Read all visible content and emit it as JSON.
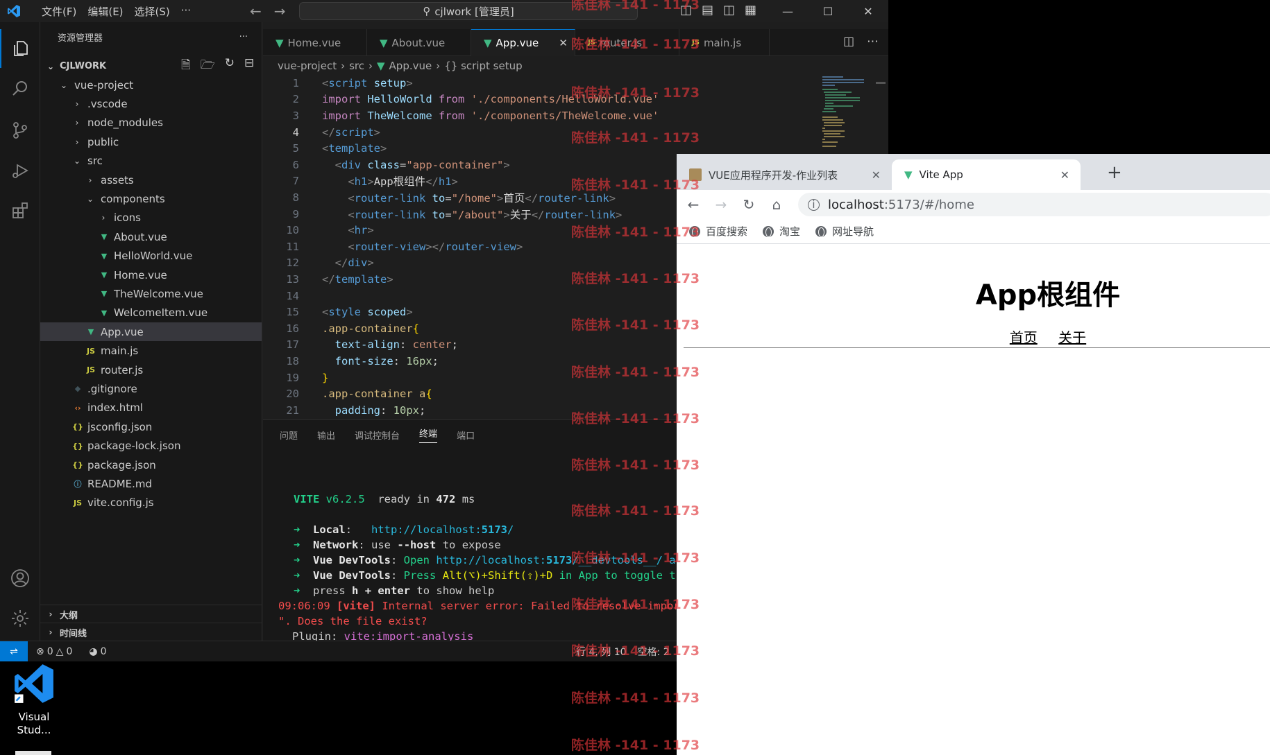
{
  "vscode": {
    "menu": [
      "文件(F)",
      "编辑(E)",
      "选择(S)",
      "···"
    ],
    "command_center": "cjlwork [管理员]",
    "activity": [
      "explorer-icon",
      "search-icon",
      "source-control-icon",
      "run-debug-icon",
      "extensions-icon",
      "account-icon",
      "settings-gear-icon"
    ],
    "sidebar": {
      "title": "资源管理器",
      "more": "···",
      "root": "CJLWORK",
      "tree": [
        {
          "label": "vue-project",
          "type": "folder-open",
          "icon": ""
        },
        {
          "label": ".vscode",
          "type": "folder",
          "icon": ""
        },
        {
          "label": "node_modules",
          "type": "folder",
          "icon": ""
        },
        {
          "label": "public",
          "type": "folder",
          "icon": ""
        },
        {
          "label": "src",
          "type": "folder-open",
          "icon": ""
        },
        {
          "label": "assets",
          "type": "folder",
          "icon": ""
        },
        {
          "label": "components",
          "type": "folder-open",
          "icon": ""
        },
        {
          "label": "icons",
          "type": "folder",
          "icon": ""
        },
        {
          "label": "About.vue",
          "type": "file",
          "icon": "vue"
        },
        {
          "label": "HelloWorld.vue",
          "type": "file",
          "icon": "vue"
        },
        {
          "label": "Home.vue",
          "type": "file",
          "icon": "vue"
        },
        {
          "label": "TheWelcome.vue",
          "type": "file",
          "icon": "vue"
        },
        {
          "label": "WelcomeItem.vue",
          "type": "file",
          "icon": "vue"
        },
        {
          "label": "App.vue",
          "type": "file",
          "icon": "vue"
        },
        {
          "label": "main.js",
          "type": "file",
          "icon": "js"
        },
        {
          "label": "router.js",
          "type": "file",
          "icon": "js"
        },
        {
          "label": ".gitignore",
          "type": "file",
          "icon": "git"
        },
        {
          "label": "index.html",
          "type": "file",
          "icon": "html"
        },
        {
          "label": "jsconfig.json",
          "type": "file",
          "icon": "json"
        },
        {
          "label": "package-lock.json",
          "type": "file",
          "icon": "json"
        },
        {
          "label": "package.json",
          "type": "file",
          "icon": "json"
        },
        {
          "label": "README.md",
          "type": "file",
          "icon": "info"
        },
        {
          "label": "vite.config.js",
          "type": "file",
          "icon": "js"
        }
      ],
      "outline": "大纲",
      "timeline": "时间线"
    },
    "tabs": [
      {
        "label": "Home.vue",
        "icon": "vue"
      },
      {
        "label": "About.vue",
        "icon": "vue"
      },
      {
        "label": "App.vue",
        "icon": "vue"
      },
      {
        "label": "router.js",
        "icon": "js"
      },
      {
        "label": "main.js",
        "icon": "js"
      }
    ],
    "js_badge": "JS",
    "breadcrumb": [
      "vue-project",
      "src",
      "App.vue",
      "{} script setup"
    ],
    "code_line_numbers": [
      "1",
      "2",
      "3",
      "4",
      "5",
      "6",
      "7",
      "8",
      "9",
      "10",
      "11",
      "12",
      "13",
      "14",
      "15",
      "16",
      "17",
      "18",
      "19",
      "20",
      "21"
    ],
    "panel_tabs": [
      "问题",
      "输出",
      "调试控制台",
      "终端",
      "端口"
    ],
    "terminal": {
      "vite": "VITE",
      "version": "v6.2.5",
      "ready": "ready in",
      "ms_value": "472",
      "ms": "ms",
      "arrow": "➜",
      "local_label": "Local",
      "local_url_prefix": "http://localhost:",
      "local_port": "5173",
      "local_url_suffix": "/",
      "network_label": "Network",
      "network_text_1": "use",
      "network_flag": "--host",
      "network_text_2": "to expose",
      "devtools_label": "Vue DevTools",
      "devtools_open": "Open",
      "devtools_url_suffix": "/__devtools__/ as",
      "devtools_press": "Press",
      "devtools_keys_1": "Alt(⌥)+Shift(⇧)+D",
      "devtools_toggle": "in App to toggle the",
      "help_press": "press",
      "help_keys": "h + enter",
      "help_text": "to show help",
      "error_time": "09:06:09",
      "error_tag": "[vite]",
      "error_msg": "Internal server error: Failed to resolve import",
      "error_msg_2": "\". Does the file exist?",
      "plugin_label": "Plugin:",
      "plugin_name": "vite:import-analysis"
    },
    "status": {
      "errors": "0",
      "warnings": "0",
      "ports": "0",
      "position": "行 4, 列 10",
      "spaces": "空格: 2"
    }
  },
  "desktop_icon": {
    "label_line1": "Visual",
    "label_line2": "Stud..."
  },
  "browser": {
    "tabs": [
      {
        "label": "VUE应用程序开发-作业列表"
      },
      {
        "label": "Vite App"
      }
    ],
    "new_tab": "+",
    "url_host": "localhost",
    "url_path": ":5173/#/home",
    "bookmarks": [
      "百度搜索",
      "淘宝",
      "网址导航"
    ],
    "page": {
      "heading": "App根组件",
      "links": [
        "首页",
        "关于"
      ]
    }
  },
  "watermark": "陈佳林 -141 - 1173",
  "colors": {
    "accent": "#0078d4",
    "vue_green": "#41b883",
    "watermark": "#e0363a"
  }
}
